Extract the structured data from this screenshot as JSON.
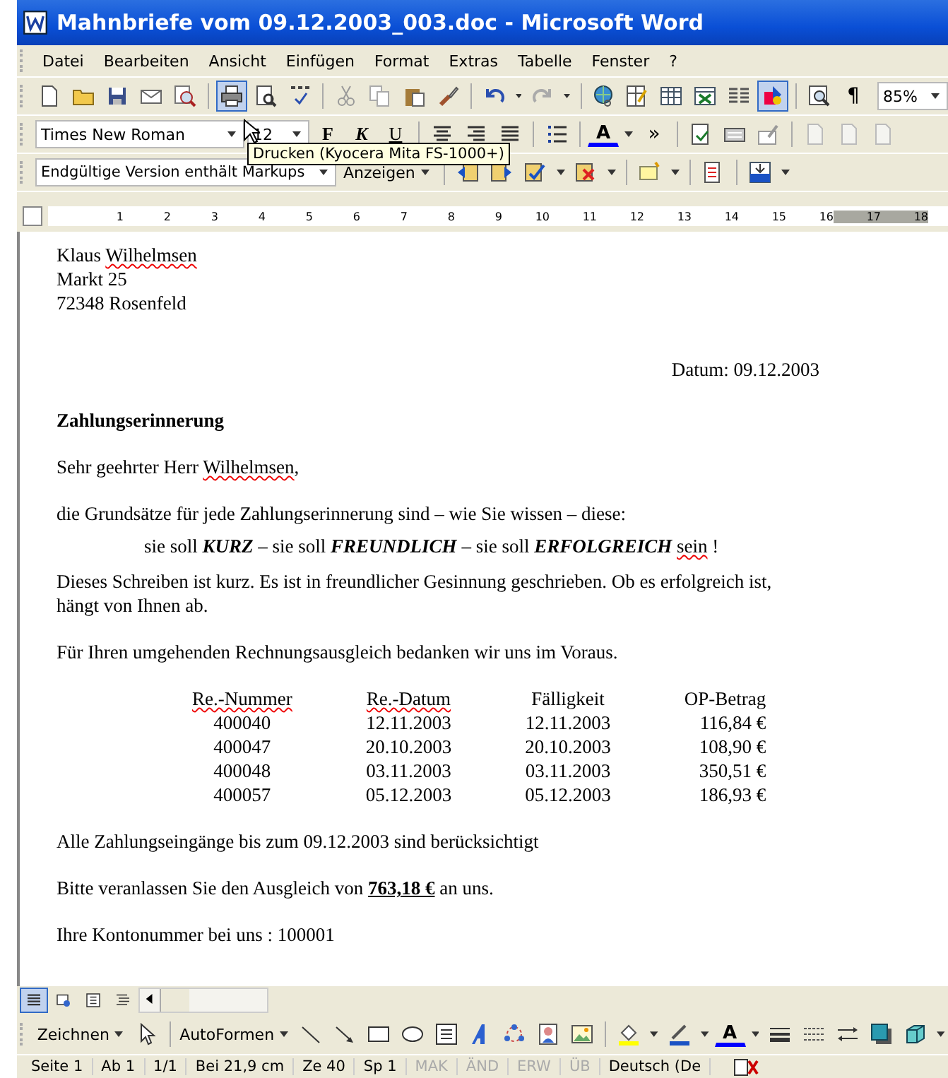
{
  "window": {
    "title": "Mahnbriefe vom 09.12.2003_003.doc - Microsoft Word"
  },
  "menu": [
    "Datei",
    "Bearbeiten",
    "Ansicht",
    "Einfügen",
    "Format",
    "Extras",
    "Tabelle",
    "Fenster",
    "?"
  ],
  "standard_toolbar": [
    {
      "kind": "page",
      "active": false
    },
    {
      "kind": "folder",
      "active": false
    },
    {
      "kind": "disk",
      "active": false
    },
    {
      "kind": "envelope",
      "active": false
    },
    {
      "kind": "magnifier",
      "active": false
    },
    {
      "kind": "sep"
    },
    {
      "kind": "printer",
      "active": true
    },
    {
      "kind": "preview",
      "active": false
    },
    {
      "kind": "spell",
      "active": false
    },
    {
      "kind": "sep"
    },
    {
      "kind": "scissors",
      "active": false
    },
    {
      "kind": "copy",
      "active": false
    },
    {
      "kind": "clipboard",
      "active": false
    },
    {
      "kind": "brush",
      "active": false
    },
    {
      "kind": "sep"
    },
    {
      "kind": "undo",
      "active": false
    },
    {
      "kind": "caret"
    },
    {
      "kind": "redo",
      "active": false
    },
    {
      "kind": "caret"
    },
    {
      "kind": "sep"
    },
    {
      "kind": "globe",
      "active": false
    },
    {
      "kind": "tablepen",
      "active": false
    },
    {
      "kind": "table",
      "active": false
    },
    {
      "kind": "sheet",
      "active": false
    },
    {
      "kind": "columns",
      "active": false
    },
    {
      "kind": "shapes",
      "active": true
    },
    {
      "kind": "sep"
    },
    {
      "kind": "docmap",
      "active": false
    },
    {
      "kind": "glyph",
      "label": "¶",
      "active": false
    }
  ],
  "zoom": {
    "value": "85%"
  },
  "format_toolbar": {
    "font": "Times New Roman",
    "size": "12",
    "items": [
      {
        "kind": "bold",
        "label": "F"
      },
      {
        "kind": "italic",
        "label": "K"
      },
      {
        "kind": "underline",
        "label": "U"
      },
      {
        "kind": "sep"
      },
      {
        "kind": "center"
      },
      {
        "kind": "right"
      },
      {
        "kind": "justify"
      },
      {
        "kind": "sep"
      },
      {
        "kind": "list"
      },
      {
        "kind": "sep"
      },
      {
        "kind": "fontcolor",
        "label": "A"
      },
      {
        "kind": "caret"
      },
      {
        "kind": "glyph",
        "label": "»"
      },
      {
        "kind": "sep"
      },
      {
        "kind": "frame"
      },
      {
        "kind": "keyboard"
      },
      {
        "kind": "formfield"
      },
      {
        "kind": "sep"
      },
      {
        "kind": "pagefaint"
      },
      {
        "kind": "pagefaint"
      },
      {
        "kind": "pagefaint"
      }
    ]
  },
  "tooltip": "Drucken (Kyocera Mita FS-1000+)",
  "review_toolbar": {
    "display": "Endgültige Version enthält Markups",
    "show_button": "Anzeigen",
    "items": [
      {
        "kind": "prevchange"
      },
      {
        "kind": "nextchange"
      },
      {
        "kind": "accept"
      },
      {
        "kind": "caret"
      },
      {
        "kind": "reject"
      },
      {
        "kind": "caret"
      },
      {
        "kind": "sep"
      },
      {
        "kind": "comment"
      },
      {
        "kind": "caret"
      },
      {
        "kind": "sep"
      },
      {
        "kind": "track"
      },
      {
        "kind": "sep"
      },
      {
        "kind": "pane"
      },
      {
        "kind": "caret"
      }
    ]
  },
  "ruler": {
    "numbers": [
      "1",
      "2",
      "3",
      "4",
      "5",
      "6",
      "7",
      "8",
      "9",
      "10",
      "11",
      "12",
      "13",
      "14",
      "15",
      "16",
      "17",
      "18"
    ]
  },
  "document": {
    "blocks": [
      {
        "kind": "address",
        "parts": [
          {
            "text": "Klaus "
          },
          {
            "text": "Wilhelmsen",
            "kind": "misspelled"
          }
        ]
      },
      {
        "kind": "address",
        "parts": [
          {
            "text": "Markt 25"
          }
        ]
      },
      {
        "kind": "address",
        "parts": [
          {
            "text": "72348 Rosenfeld"
          }
        ]
      },
      {
        "kind": "date",
        "parts": [
          {
            "text": "Datum: 09.12.2003"
          }
        ]
      },
      {
        "kind": "heading",
        "parts": [
          {
            "text": "Zahlungserinnerung"
          }
        ]
      },
      {
        "kind": "para",
        "parts": [
          {
            "text": "Sehr geehrter Herr "
          },
          {
            "text": "Wilhelmsen",
            "kind": "misspelled"
          },
          {
            "text": ","
          }
        ]
      },
      {
        "kind": "para",
        "parts": [
          {
            "text": "die Grundsätze für jede Zahlungserinnerung sind – wie Sie wissen – diese:"
          }
        ]
      },
      {
        "kind": "indent",
        "parts": [
          {
            "text": "sie soll "
          },
          {
            "text": "KURZ",
            "kind": "emphasis"
          },
          {
            "text": " – sie soll "
          },
          {
            "text": "FREUNDLICH",
            "kind": "emphasis"
          },
          {
            "text": " – sie soll "
          },
          {
            "text": "ERFOLGREICH ",
            "kind": "emphasis"
          },
          {
            "text": "sein",
            "kind": "misspelled"
          },
          {
            "text": " !"
          }
        ]
      },
      {
        "kind": "continued",
        "parts": [
          {
            "text": "Dieses Schreiben ist kurz. Es ist in freundlicher Gesinnung geschrieben. Ob es  erfolgreich ist,\nhängt von Ihnen ab."
          }
        ]
      },
      {
        "kind": "para",
        "parts": [
          {
            "text": "Für Ihren umgehenden Rechnungsausgleich bedanken wir uns im Voraus."
          }
        ]
      },
      {
        "kind": "table",
        "columns": [
          {
            "label": "Re.-Nummer",
            "misspelled": true
          },
          {
            "label": "Re.-Datum",
            "misspelled": true
          },
          {
            "label": "Fälligkeit",
            "misspelled": false
          },
          {
            "label": "OP-Betrag",
            "misspelled": false
          }
        ],
        "rows": [
          [
            "400040",
            "12.11.2003",
            "12.11.2003",
            "116,84 €"
          ],
          [
            "400047",
            "20.10.2003",
            "20.10.2003",
            "108,90 €"
          ],
          [
            "400048",
            "03.11.2003",
            "03.11.2003",
            "350,51 €"
          ],
          [
            "400057",
            "05.12.2003",
            "05.12.2003",
            "186,93 €"
          ]
        ]
      },
      {
        "kind": "para",
        "parts": [
          {
            "text": "Alle Zahlungseingänge bis zum 09.12.2003 sind berücksichtigt"
          }
        ]
      },
      {
        "kind": "para",
        "parts": [
          {
            "text": "Bitte veranlassen Sie den Ausgleich von "
          },
          {
            "text": "763,18 €",
            "kind": "amount"
          },
          {
            "text": " an uns."
          }
        ]
      },
      {
        "kind": "para",
        "parts": [
          {
            "text": "Ihre Kontonummer bei uns : 100001"
          }
        ]
      }
    ]
  },
  "view_buttons": [
    {
      "kind": "normal",
      "selected": true
    },
    {
      "kind": "web",
      "selected": false
    },
    {
      "kind": "print",
      "selected": false
    },
    {
      "kind": "outline",
      "selected": false
    }
  ],
  "drawing_toolbar": {
    "draw_menu": "Zeichnen",
    "autoshapes": "AutoFormen",
    "items": [
      {
        "kind": "line"
      },
      {
        "kind": "arrow"
      },
      {
        "kind": "rect"
      },
      {
        "kind": "oval"
      },
      {
        "kind": "textbox"
      },
      {
        "kind": "wordart"
      },
      {
        "kind": "diagram"
      },
      {
        "kind": "clipart"
      },
      {
        "kind": "picture"
      },
      {
        "kind": "sep"
      },
      {
        "kind": "fill"
      },
      {
        "kind": "caret"
      },
      {
        "kind": "linecolor"
      },
      {
        "kind": "caret"
      },
      {
        "kind": "fontcolor",
        "label": "A"
      },
      {
        "kind": "caret"
      },
      {
        "kind": "linestyle"
      },
      {
        "kind": "dashstyle"
      },
      {
        "kind": "arrowstyle"
      },
      {
        "kind": "shadow"
      },
      {
        "kind": "cube"
      },
      {
        "kind": "caret"
      }
    ]
  },
  "status_bar": {
    "fields": [
      {
        "text": "Seite 1",
        "enabled": true
      },
      {
        "text": "Ab 1",
        "enabled": true
      },
      {
        "text": "1/1",
        "enabled": true
      },
      {
        "text": "Bei 21,9 cm",
        "enabled": true
      },
      {
        "text": "Ze 40",
        "enabled": true
      },
      {
        "text": "Sp 1",
        "enabled": true
      },
      {
        "text": "MAK",
        "enabled": false
      },
      {
        "text": "ÄND",
        "enabled": false
      },
      {
        "text": "ERW",
        "enabled": false
      },
      {
        "text": "ÜB",
        "enabled": false
      },
      {
        "text": "Deutsch (De",
        "enabled": true
      }
    ]
  }
}
